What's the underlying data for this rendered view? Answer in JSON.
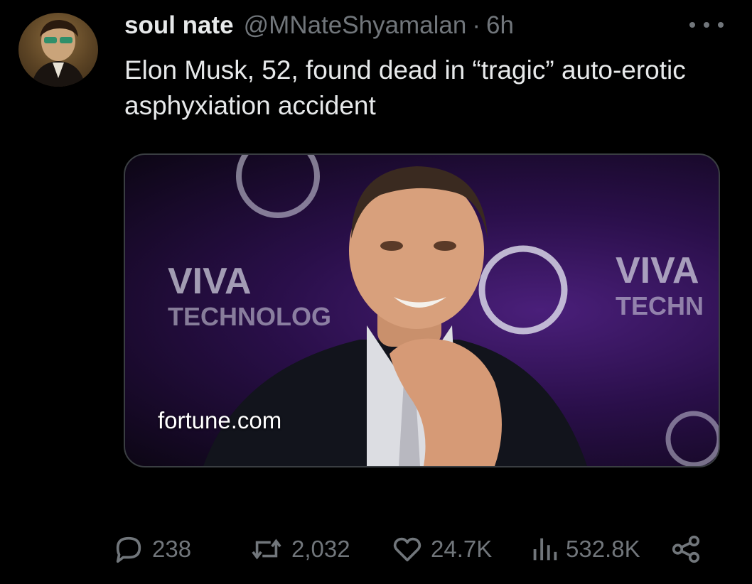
{
  "tweet": {
    "author_name": "soul nate",
    "handle": "@MNateShyamalan",
    "separator": "·",
    "time": "6h",
    "text": "Elon Musk, 52, found dead in “tragic” auto-erotic asphyxiation accident"
  },
  "card": {
    "source": "fortune.com",
    "backdrop_texts": [
      "VIVA",
      "TECHNOLOG",
      "VIVA",
      "TECHN"
    ]
  },
  "actions": {
    "replies": "238",
    "retweets": "2,032",
    "likes": "24.7K",
    "views": "532.8K"
  },
  "icons": [
    "more-icon",
    "reply-icon",
    "retweet-icon",
    "like-icon",
    "views-icon",
    "share-icon"
  ],
  "colors": {
    "background": "#000000",
    "text": "#e7e9ea",
    "muted": "#71767b",
    "card_border": "#3a3e42"
  }
}
